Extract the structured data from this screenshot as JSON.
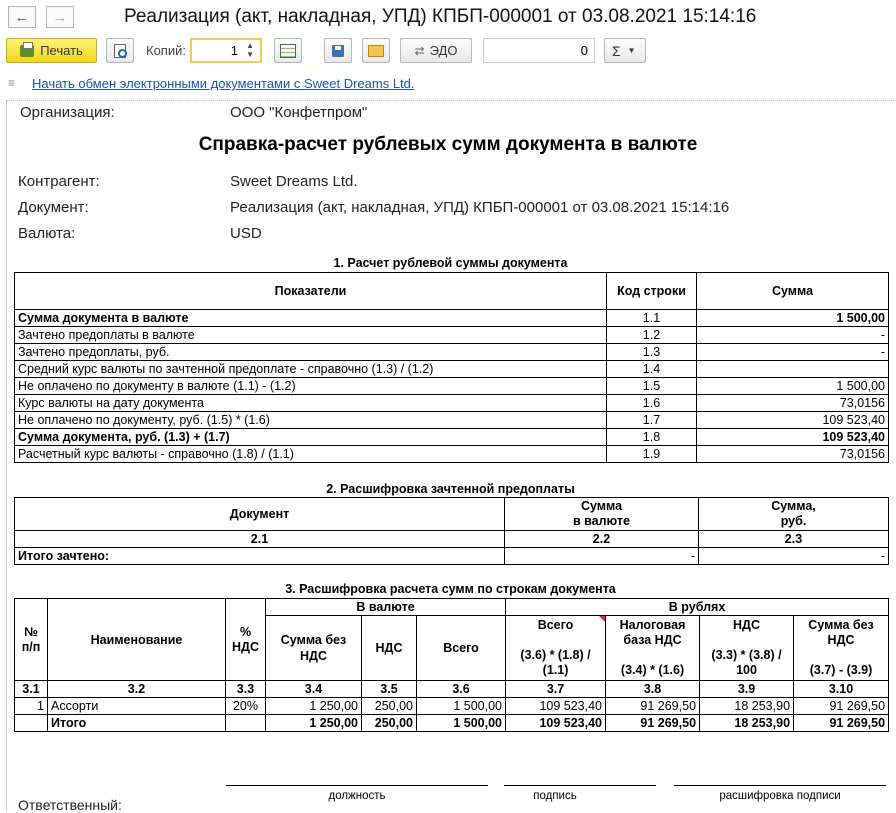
{
  "window": {
    "title": "Реализация (акт, накладная, УПД) КПБП-000001 от 03.08.2021 15:14:16",
    "back_icon": "arrow-left-icon",
    "forward_icon": "arrow-right-icon"
  },
  "toolbar": {
    "print_label": "Печать",
    "copies_label": "Копий:",
    "copies_value": "1",
    "edo_label": "ЭДО",
    "counter_value": "0",
    "sum_label": "Σ",
    "print_color": "#f5dc2a"
  },
  "edo_link": "Начать обмен электронными документами с Sweet Dreams Ltd.",
  "doc": {
    "org_label": "Организация:",
    "org_value": "ООО \"Конфетпром\"",
    "title": "Справка-расчет рублевых сумм документа в валюте",
    "contractor_label": "Контрагент:",
    "contractor_value": "Sweet Dreams Ltd.",
    "document_label": "Документ:",
    "document_value": "Реализация (акт, накладная, УПД) КПБП-000001 от 03.08.2021 15:14:16",
    "currency_label": "Валюта:",
    "currency_value": "USD"
  },
  "section1": {
    "title": "1. Расчет рублевой суммы документа",
    "headers": [
      "Показатели",
      "Код строки",
      "Сумма"
    ],
    "rows": [
      {
        "name": "Сумма документа в валюте",
        "code": "1.1",
        "sum": "1 500,00",
        "bold": true
      },
      {
        "name": "Зачтено предоплаты в валюте",
        "code": "1.2",
        "sum": "-",
        "bold": false
      },
      {
        "name": "Зачтено предоплаты, руб.",
        "code": "1.3",
        "sum": "-",
        "bold": false
      },
      {
        "name": "Средний курс валюты по зачтенной предоплате - справочно  (1.3) / (1.2)",
        "code": "1.4",
        "sum": "",
        "bold": false
      },
      {
        "name": "Не оплачено по документу в валюте  (1.1) - (1.2)",
        "code": "1.5",
        "sum": "1 500,00",
        "bold": false
      },
      {
        "name": "Курс валюты на дату документа",
        "code": "1.6",
        "sum": "73,0156",
        "bold": false
      },
      {
        "name": "Не оплачено по документу, руб. (1.5) * (1.6)",
        "code": "1.7",
        "sum": "109 523,40",
        "bold": false
      },
      {
        "name": "Сумма документа, руб. (1.3) + (1.7)",
        "code": "1.8",
        "sum": "109 523,40",
        "bold": true
      },
      {
        "name": "Расчетный курс валюты - справочно (1.8) / (1.1)",
        "code": "1.9",
        "sum": "73,0156",
        "bold": false
      }
    ]
  },
  "section2": {
    "title": "2. Расшифровка зачтенной предоплаты",
    "col_doc": "Документ",
    "col_sum_cur_1": "Сумма",
    "col_sum_cur_2": "в валюте",
    "col_sum_rub_1": "Сумма,",
    "col_sum_rub_2": "руб.",
    "num_1": "2.1",
    "num_2": "2.2",
    "num_3": "2.3",
    "total_label": "Итого зачтено:",
    "total_cur": "-",
    "total_rub": "-"
  },
  "section3": {
    "title": "3. Расшифровка расчета сумм по строкам документа",
    "h_num_1": "№",
    "h_num_2": "п/п",
    "h_name": "Наименование",
    "h_vat_1": "%",
    "h_vat_2": "НДС",
    "h_in_currency": "В валюте",
    "h_in_rub": "В рублях",
    "h_sum_wo_vat_1": "Сумма без",
    "h_sum_wo_vat_2": "НДС",
    "h_vat": "НДС",
    "h_total": "Всего",
    "h_r_total_1": "Всего",
    "h_r_total_2": "(3.6) * (1.8) /",
    "h_r_total_3": "(1.1)",
    "h_r_base_1": "Налоговая",
    "h_r_base_2": "база НДС",
    "h_r_base_3": "(3.4) * (1.6)",
    "h_r_vat_1": "НДС",
    "h_r_vat_2": "(3.3) * (3.8) /",
    "h_r_vat_3": "100",
    "h_r_wo_1": "Сумма без",
    "h_r_wo_2": "НДС",
    "h_r_wo_3": "(3.7) - (3.9)",
    "nums": [
      "3.1",
      "3.2",
      "3.3",
      "3.4",
      "3.5",
      "3.6",
      "3.7",
      "3.8",
      "3.9",
      "3.10"
    ],
    "row": {
      "n": "1",
      "name": "Ассорти",
      "vat": "20%",
      "sum_wo": "1 250,00",
      "vat_sum": "250,00",
      "total": "1 500,00",
      "r_total": "109 523,40",
      "r_base": "91 269,50",
      "r_vat": "18 253,90",
      "r_wo": "91 269,50"
    },
    "total": {
      "label": "Итого",
      "sum_wo": "1 250,00",
      "vat_sum": "250,00",
      "total": "1 500,00",
      "r_total": "109 523,40",
      "r_base": "91 269,50",
      "r_vat": "18 253,90",
      "r_wo": "91 269,50"
    }
  },
  "signature": {
    "responsible_label": "Ответственный:",
    "position_caption": "должность",
    "sign_caption": "подпись",
    "decode_caption": "расшифровка подписи"
  }
}
